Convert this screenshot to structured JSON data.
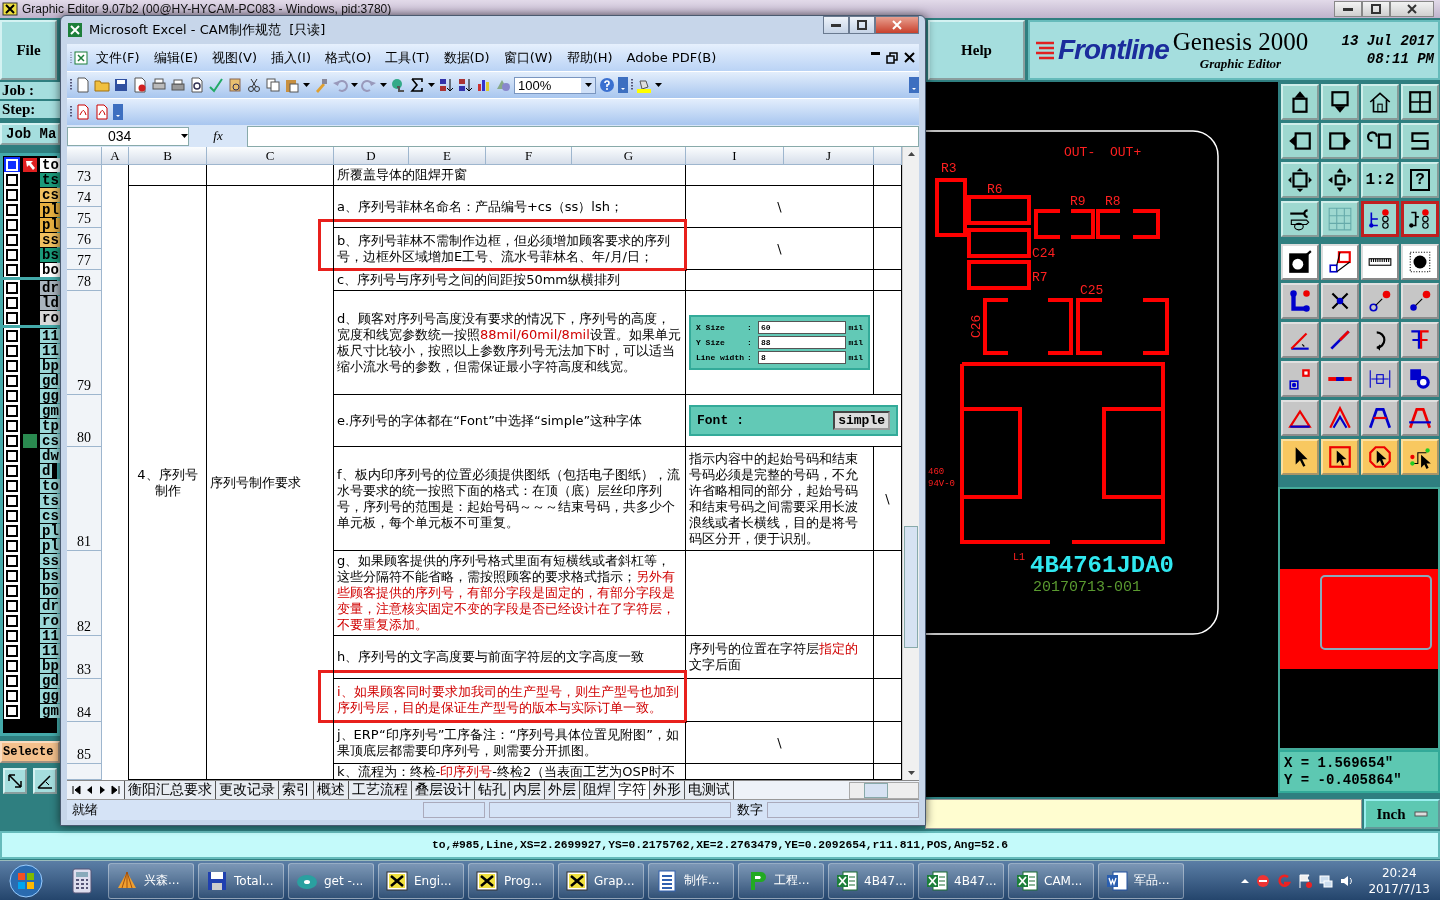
{
  "genesis": {
    "title": "Graphic Editor 9.07b2 (00@HY-HYCAM-PC083 - Windows, pid:3780)",
    "file_menu": "File",
    "help_menu": "Help",
    "brand": {
      "logo": "Frontline",
      "product": "Genesis 2000",
      "subtitle": "Graphic Editor",
      "date": "13 Jul 2017",
      "time": "08:11 PM"
    },
    "job_label": "Job :",
    "step_label": "Step:",
    "job_button": "Job Ma",
    "layer_groups": [
      {
        "layers": [
          {
            "name": "to",
            "color": "#ffffff",
            "affected": true,
            "work_layer": true,
            "marked": false
          },
          {
            "name": "ts",
            "color": "#1a9a7a",
            "affected": false,
            "work_layer": false,
            "marked": false
          },
          {
            "name": "cs",
            "color": "#f0c060",
            "affected": false,
            "work_layer": false,
            "marked": false
          },
          {
            "name": "pl",
            "color": "#e8b040",
            "affected": false,
            "work_layer": false,
            "marked": false
          },
          {
            "name": "pl",
            "color": "#e8b040",
            "affected": false,
            "work_layer": false,
            "marked": false
          },
          {
            "name": "ss",
            "color": "#f0c060",
            "affected": false,
            "work_layer": false,
            "marked": false
          },
          {
            "name": "bs",
            "color": "#1a9a7a",
            "affected": false,
            "work_layer": false,
            "marked": false
          },
          {
            "name": "bo",
            "color": "#ffffff",
            "affected": false,
            "work_layer": false,
            "marked": false
          }
        ]
      },
      {
        "layers": [
          {
            "name": "dr",
            "color": "#a9b4bf",
            "affected": false,
            "work_layer": false,
            "marked": false
          },
          {
            "name": "ld",
            "color": "#a9b4bf",
            "affected": false,
            "work_layer": false,
            "marked": false
          },
          {
            "name": "ro",
            "color": "#d9d9d9",
            "affected": false,
            "work_layer": false,
            "marked": false
          }
        ]
      },
      {
        "layers": [
          {
            "name": "11",
            "color": "#9ad8d8",
            "affected": false,
            "work_layer": false,
            "marked": false
          },
          {
            "name": "11",
            "color": "#9ad8d8",
            "affected": false,
            "work_layer": false,
            "marked": false
          },
          {
            "name": "bp",
            "color": "#9ad8d8",
            "affected": false,
            "work_layer": false,
            "marked": false
          },
          {
            "name": "gd",
            "color": "#9ad8d8",
            "affected": false,
            "work_layer": false,
            "marked": false
          },
          {
            "name": "gg",
            "color": "#9ad8d8",
            "affected": false,
            "work_layer": false,
            "marked": false
          },
          {
            "name": "gm",
            "color": "#9ad8d8",
            "affected": false,
            "work_layer": false,
            "marked": false
          },
          {
            "name": "tp",
            "color": "#9ad8d8",
            "affected": false,
            "work_layer": false,
            "marked": false
          },
          {
            "name": "cs",
            "color": "#9ad8d8",
            "affected": false,
            "work_layer": false,
            "marked": true
          },
          {
            "name": "dw",
            "color": "#9ad8d8",
            "affected": false,
            "work_layer": false,
            "marked": false
          },
          {
            "name": "d",
            "color": "#9ad8d8",
            "affected": false,
            "work_layer": false,
            "marked": false
          },
          {
            "name": "to",
            "color": "#9ad8d8",
            "affected": false,
            "work_layer": false,
            "marked": false
          },
          {
            "name": "ts",
            "color": "#9ad8d8",
            "affected": false,
            "work_layer": false,
            "marked": false
          },
          {
            "name": "cs",
            "color": "#9ad8d8",
            "affected": false,
            "work_layer": false,
            "marked": false
          },
          {
            "name": "pl",
            "color": "#9ad8d8",
            "affected": false,
            "work_layer": false,
            "marked": false
          },
          {
            "name": "pl",
            "color": "#9ad8d8",
            "affected": false,
            "work_layer": false,
            "marked": false
          },
          {
            "name": "ss",
            "color": "#9ad8d8",
            "affected": false,
            "work_layer": false,
            "marked": false
          },
          {
            "name": "bs",
            "color": "#9ad8d8",
            "affected": false,
            "work_layer": false,
            "marked": false
          },
          {
            "name": "bo",
            "color": "#9ad8d8",
            "affected": false,
            "work_layer": false,
            "marked": false
          },
          {
            "name": "dr",
            "color": "#9ad8d8",
            "affected": false,
            "work_layer": false,
            "marked": false
          },
          {
            "name": "ro",
            "color": "#9ad8d8",
            "affected": false,
            "work_layer": false,
            "marked": false
          },
          {
            "name": "11",
            "color": "#9ad8d8",
            "affected": false,
            "work_layer": false,
            "marked": false
          },
          {
            "name": "11",
            "color": "#9ad8d8",
            "affected": false,
            "work_layer": false,
            "marked": false
          },
          {
            "name": "bp",
            "color": "#9ad8d8",
            "affected": false,
            "work_layer": false,
            "marked": false
          },
          {
            "name": "gd",
            "color": "#9ad8d8",
            "affected": false,
            "work_layer": false,
            "marked": false
          },
          {
            "name": "gg",
            "color": "#9ad8d8",
            "affected": false,
            "work_layer": false,
            "marked": false
          },
          {
            "name": "gm",
            "color": "#9ad8d8",
            "affected": false,
            "work_layer": false,
            "marked": false
          }
        ]
      }
    ],
    "selected_button": "Selecte",
    "canvas": {
      "labels": [
        "OUT-",
        "OUT+",
        "R3",
        "R6",
        "R9",
        "R8",
        "C24",
        "R7",
        "C25",
        "C26",
        "460",
        "94V-0",
        "L1"
      ],
      "serial": "4B4761JDA0",
      "date_code": "20170713-001"
    },
    "tools": {
      "ratio": "1:2",
      "help": "?"
    },
    "coordinates": {
      "x": "X = 1.569654\"",
      "y": "Y = -0.405864\""
    },
    "units": "Inch",
    "status_line": "to,#985,Line,XS=2.2699927,YS=0.2175762,XE=2.2763479,YE=0.2092654,r11.811,POS,Ang=52.6"
  },
  "excel": {
    "title": "Microsoft Excel - CAM制作规范  [只读]",
    "menus": [
      "文件(F)",
      "编辑(E)",
      "视图(V)",
      "插入(I)",
      "格式(O)",
      "工具(T)",
      "数据(D)",
      "窗口(W)",
      "帮助(H)",
      "Adobe PDF(B)"
    ],
    "zoom": "100%",
    "name_box": "034",
    "formula_label": "fx",
    "columns": [
      "A",
      "B",
      "C",
      "D",
      "E",
      "F",
      "G",
      "I",
      "J"
    ],
    "section": "4、序列号制作",
    "topic": "序列号制作要求",
    "entries": [
      {
        "row_numbers": [
          "73"
        ],
        "requirement": [
          {
            "text": "所覆盖导体的阻焊开窗",
            "red": false
          }
        ],
        "highlighted": false
      },
      {
        "row_numbers": [
          "74",
          "75"
        ],
        "requirement": [
          {
            "text": "a、序列号菲林名命名：产品编号+cs（ss）lsh；",
            "red": false
          }
        ],
        "highlighted": false,
        "note": {
          "kind": "symbol",
          "runs": [
            {
              "text": "\\",
              "red": false
            }
          ]
        }
      },
      {
        "row_numbers": [
          "76",
          "77"
        ],
        "requirement": [
          {
            "text": "b、序列号菲林不需制作边框，但必须增加顾客要求的序列号，边框外区域增加E工号、流水号菲林名、年/月/日；",
            "red": false
          }
        ],
        "highlighted": true,
        "note": {
          "kind": "symbol",
          "runs": [
            {
              "text": "\\",
              "red": false
            }
          ]
        }
      },
      {
        "row_numbers": [
          "78"
        ],
        "requirement": [
          {
            "text": "c、序列号与序列号之间的间距按50mm纵横排列",
            "red": false
          }
        ],
        "highlighted": false
      },
      {
        "row_numbers": [
          "79"
        ],
        "requirement": [
          {
            "text": "d、顾客对序列号高度没有要求的情况下，序列号的高度，宽度和线宽参数统一按照",
            "red": false
          },
          {
            "text": "88mil/60mil/8mil",
            "red": true
          },
          {
            "text": "设置。如果单元板尺寸比较小，按照以上参数序列号无法加下时，可以适当缩小流水号的参数，但需保证最小字符高度和线宽。",
            "red": false
          }
        ],
        "highlighted": false,
        "note": {
          "kind": "size_dialog",
          "fields": [
            {
              "label": "X Size",
              "separator": ":",
              "value": "60",
              "unit": "mil"
            },
            {
              "label": "Y Size",
              "separator": ":",
              "value": "88",
              "unit": "mil"
            },
            {
              "label": "Line width",
              "separator": ":",
              "value": "8",
              "unit": "mil"
            }
          ]
        }
      },
      {
        "row_numbers": [
          "80"
        ],
        "requirement": [
          {
            "text": "e.序列号的字体都在“Font”中选择“simple”这种字体",
            "red": false
          }
        ],
        "highlighted": false,
        "note": {
          "kind": "font_dialog",
          "label": "Font",
          "separator": ":",
          "value": "simple"
        }
      },
      {
        "row_numbers": [
          "81"
        ],
        "requirement": [
          {
            "text": "f、板内印序列号的位置必须提供图纸（包括电子图纸），流水号要求的统一按照下面的格式：在顶（底）层丝印序列号，序列号的范围是：起始号码～～～结束号码，共多少个单元板，每个单元板不可重复。",
            "red": false
          }
        ],
        "highlighted": false,
        "note": {
          "kind": "text",
          "runs": [
            {
              "text": "指示内容中的起始号码和结束号码必须是完整的号码，不允许省略相同的部分，起始号码和结束号码之间需要采用长波浪线或者长横线，目的是将号码区分开，便于识别。",
              "red": false
            }
          ]
        },
        "extra_mark": "\\"
      },
      {
        "row_numbers": [
          "82"
        ],
        "requirement": [
          {
            "text": "g、如果顾客提供的序列号格式里面有短横线或者斜杠等，这些分隔符不能省略，需按照顾客的要求格式指示；",
            "red": false
          },
          {
            "text": "另外有些顾客提供的序列号，有部分字段是固定的，有部分字段是变量，注意核实固定不变的字段是否已经设计在了字符层，不要重复添加。",
            "red": true
          }
        ],
        "highlighted": false
      },
      {
        "row_numbers": [
          "83"
        ],
        "requirement": [
          {
            "text": "h、序列号的文字高度要与前面字符层的文字高度一致",
            "red": false
          }
        ],
        "highlighted": false,
        "note": {
          "kind": "text",
          "runs": [
            {
              "text": "序列号的位置在字符层",
              "red": false
            },
            {
              "text": "指定的",
              "red": true
            },
            {
              "text": "文字后面",
              "red": false
            }
          ]
        }
      },
      {
        "row_numbers": [
          "84"
        ],
        "requirement": [
          {
            "text": "i、如果顾客同时要求加我司的生产型号，则生产型号也加到序列号层，目的是保证生产型号的版本与实际订单一致。",
            "red": true
          }
        ],
        "highlighted": true
      },
      {
        "row_numbers": [
          "85"
        ],
        "requirement": [
          {
            "text": "j、ERP“印序列号”工序备注：“序列号具体位置见附图”，如果顶底层都需要印序列号，则需要分开抓图。",
            "red": false
          }
        ],
        "highlighted": false,
        "note": {
          "kind": "symbol",
          "runs": [
            {
              "text": "\\",
              "red": false
            }
          ]
        }
      },
      {
        "requirement": [
          {
            "text": "k、流程为：终检-",
            "red": false
          },
          {
            "text": "印序列号",
            "red": true
          },
          {
            "text": "-终检2（当表面工艺为OSP时不",
            "red": false
          }
        ],
        "highlighted": false
      }
    ],
    "sheet_tabs": [
      {
        "label": "衡阳汇总要求",
        "selected": false
      },
      {
        "label": "更改记录",
        "selected": false
      },
      {
        "label": "索引",
        "selected": false
      },
      {
        "label": "概述",
        "selected": false
      },
      {
        "label": "工艺流程",
        "selected": false
      },
      {
        "label": "叠层设计",
        "selected": false
      },
      {
        "label": "钻孔",
        "selected": false
      },
      {
        "label": "内层",
        "selected": false
      },
      {
        "label": "外层",
        "selected": false
      },
      {
        "label": "阻焊",
        "selected": false
      },
      {
        "label": "字符",
        "selected": true
      },
      {
        "label": "外形",
        "selected": false
      },
      {
        "label": "电测试",
        "selected": false
      }
    ],
    "status": "就绪",
    "num_mode": "数字"
  },
  "taskbar": {
    "items": [
      {
        "label": "兴森..."
      },
      {
        "label": "Total..."
      },
      {
        "label": "get -..."
      },
      {
        "label": "Engi..."
      },
      {
        "label": "Prog..."
      },
      {
        "label": "Grap..."
      },
      {
        "label": "制作..."
      },
      {
        "label": "工程..."
      },
      {
        "label": "4B47..."
      },
      {
        "label": "4B47..."
      },
      {
        "label": "CAM..."
      },
      {
        "label": "军品..."
      }
    ],
    "time": "20:24",
    "date": "2017/7/13"
  }
}
